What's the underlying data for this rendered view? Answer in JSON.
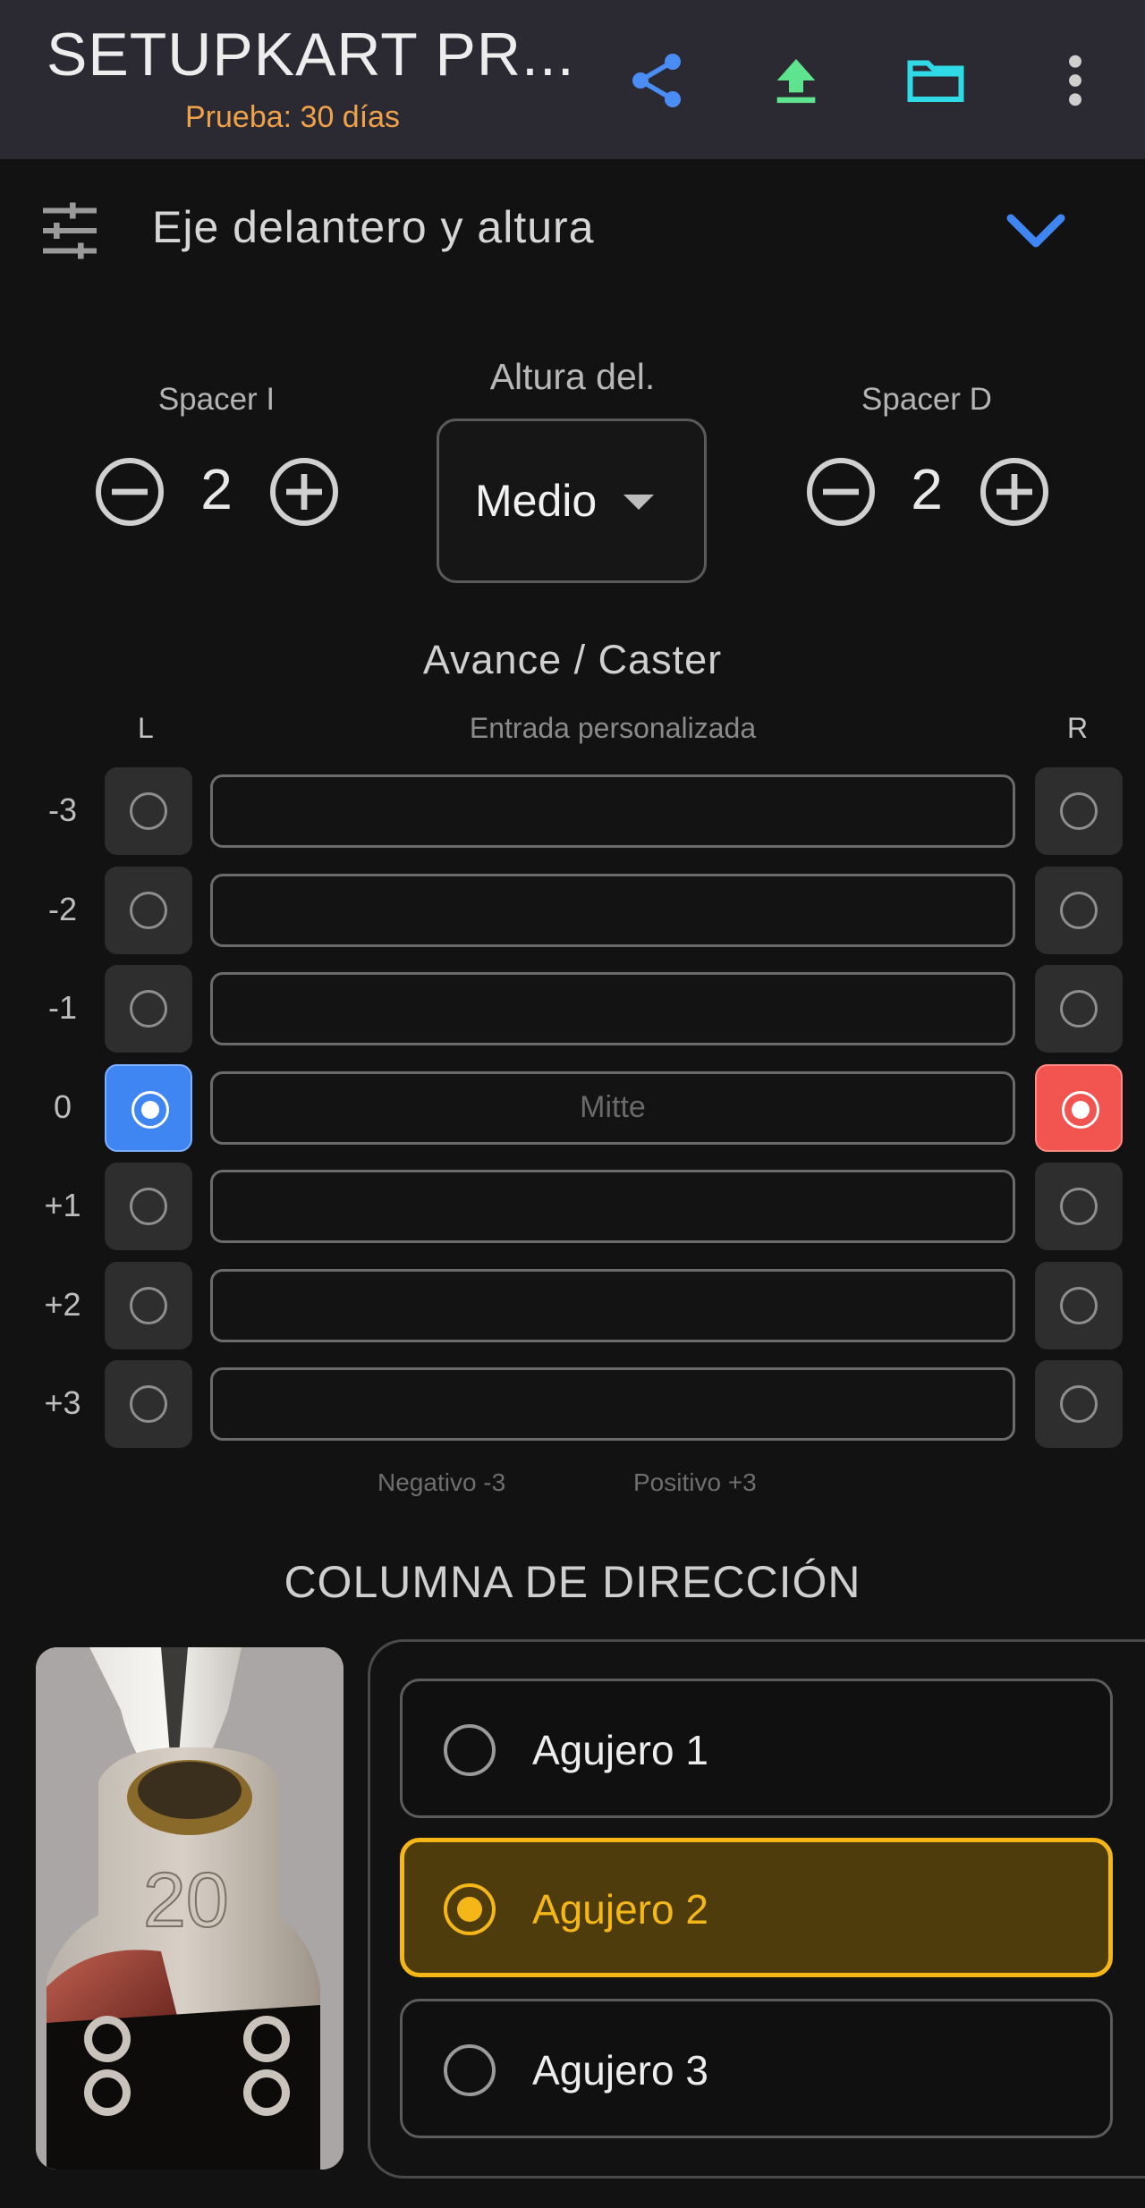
{
  "appbar": {
    "title": "SETUPKART PR...",
    "subtitle": "Prueba: 30 días",
    "icons": [
      "share-icon",
      "upload-icon",
      "folder-icon",
      "more-vert-icon"
    ],
    "colors": {
      "share": "#4a8df5",
      "upload": "#5ee38e",
      "folder": "#2fd9e6",
      "more": "#cfcfcf",
      "subtitle": "#f0a24a"
    }
  },
  "section": {
    "title": "Eje delantero y altura",
    "icon": "tune-icon",
    "expand_icon": "chevron-down-icon"
  },
  "spacers": {
    "left_label": "Spacer I",
    "left_value": "2",
    "right_label": "Spacer D",
    "right_value": "2"
  },
  "front_height": {
    "label": "Altura del.",
    "value": "Medio"
  },
  "caster": {
    "title": "Avance / Caster",
    "col_left": "L",
    "col_custom": "Entrada personalizada",
    "col_right": "R",
    "rows": [
      {
        "label": "-3",
        "placeholder": "",
        "left_selected": false,
        "right_selected": false
      },
      {
        "label": "-2",
        "placeholder": "",
        "left_selected": false,
        "right_selected": false
      },
      {
        "label": "-1",
        "placeholder": "",
        "left_selected": false,
        "right_selected": false
      },
      {
        "label": "0",
        "placeholder": "Mitte",
        "left_selected": true,
        "right_selected": true
      },
      {
        "label": "+1",
        "placeholder": "",
        "left_selected": false,
        "right_selected": false
      },
      {
        "label": "+2",
        "placeholder": "",
        "left_selected": false,
        "right_selected": false
      },
      {
        "label": "+3",
        "placeholder": "",
        "left_selected": false,
        "right_selected": false
      }
    ],
    "hint_negative": "Negativo -3",
    "hint_positive": "Positivo +3",
    "colors": {
      "left_selected": "#3f86f2",
      "right_selected": "#f2544f"
    }
  },
  "steering": {
    "title": "COLUMNA DE DIRECCIÓN",
    "photo_engraving": "20",
    "options": [
      {
        "label": "Agujero 1",
        "selected": false
      },
      {
        "label": "Agujero 2",
        "selected": true
      },
      {
        "label": "Agujero 3",
        "selected": false
      }
    ],
    "colors": {
      "selected": "#f5b617",
      "selected_bg": "#4f3c0c"
    }
  }
}
